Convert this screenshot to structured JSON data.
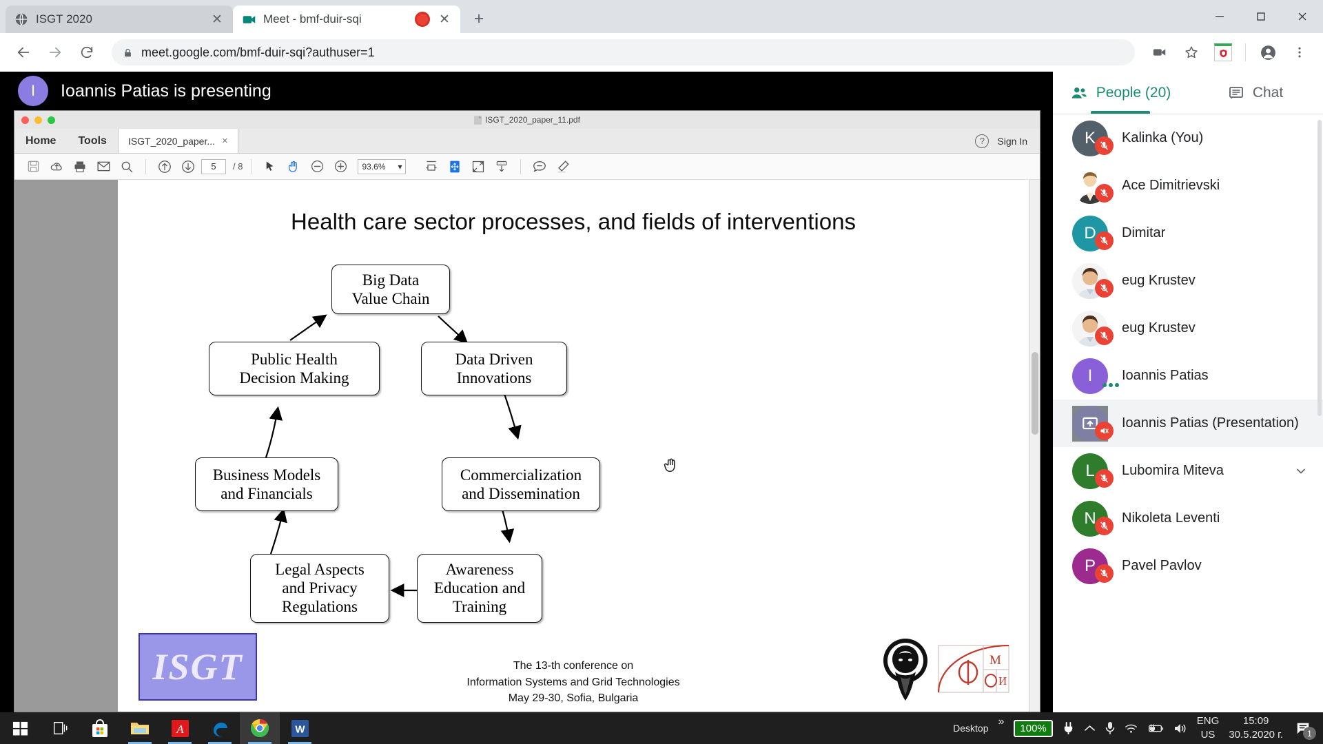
{
  "browser": {
    "tabs": [
      {
        "title": "ISGT 2020",
        "favicon": "globe-icon",
        "active": false,
        "recording": false
      },
      {
        "title": "Meet - bmf-duir-sqi",
        "favicon": "meet-icon",
        "active": true,
        "recording": true
      }
    ],
    "new_tab_label": "+",
    "window_controls": {
      "minimize": "—",
      "maximize": "☐",
      "close": "✕"
    },
    "url": "meet.google.com/bmf-duir-sqi?authuser=1",
    "nav": {
      "back": "←",
      "forward": "→",
      "reload": "↻"
    },
    "icons": {
      "lock": "lock-icon",
      "camera": "camera-icon",
      "bookmark": "star-icon",
      "extension": "avast-extension-icon",
      "profile": "profile-icon",
      "menu": "kebab-menu-icon"
    }
  },
  "meet": {
    "presenting": {
      "avatar_letter": "I",
      "text": "Ioannis Patias is presenting",
      "avatar_color": "#8a7ce0"
    },
    "panel": {
      "tabs": [
        {
          "label": "People (20)",
          "icon": "people-icon",
          "active": true
        },
        {
          "label": "Chat",
          "icon": "chat-icon",
          "active": false
        }
      ],
      "participants": [
        {
          "name": "Kalinka (You)",
          "initial": "K",
          "color": "#546069",
          "type": "initial",
          "muted": true,
          "highlight": false
        },
        {
          "name": "Ace Dimitrievski",
          "initial": "",
          "color": "#ffffff",
          "type": "photo-generic",
          "muted": true,
          "highlight": false
        },
        {
          "name": "Dimitar",
          "initial": "D",
          "color": "#1f96a4",
          "type": "initial",
          "muted": true,
          "highlight": false
        },
        {
          "name": "eug Krustev",
          "initial": "",
          "color": "#ffffff",
          "type": "photo-man",
          "muted": true,
          "highlight": false
        },
        {
          "name": "eug Krustev",
          "initial": "",
          "color": "#ffffff",
          "type": "photo-man",
          "muted": true,
          "highlight": false
        },
        {
          "name": "Ioannis Patias",
          "initial": "I",
          "color": "#8a60d8",
          "type": "initial",
          "muted": false,
          "speaking": true,
          "highlight": false
        },
        {
          "name": "Ioannis Patias (Presentation)",
          "initial": "",
          "color": "#7e7fa3",
          "type": "presentation",
          "muted": true,
          "audio_off": true,
          "highlight": true
        },
        {
          "name": "Lubomira Miteva",
          "initial": "L",
          "color": "#2d7d2d",
          "type": "initial",
          "muted": true,
          "highlight": false,
          "expandable": true
        },
        {
          "name": "Nikoleta Leventi",
          "initial": "N",
          "color": "#2d7d2d",
          "type": "initial",
          "muted": true,
          "highlight": false
        },
        {
          "name": "Pavel Pavlov",
          "initial": "P",
          "color": "#9c2a8f",
          "type": "initial",
          "muted": true,
          "highlight": false
        }
      ],
      "collapse_icon": "collapse-left-arrow-icon"
    }
  },
  "acrobat": {
    "window_filename": "ISGT_2020_paper_11.pdf",
    "menus": [
      "Home",
      "Tools"
    ],
    "document_tab": "ISGT_2020_paper...",
    "document_tab_close": "×",
    "sign_in": "Sign In",
    "help_icon": "help-icon",
    "toolbar": {
      "save_icon": "save-icon",
      "cloud_icon": "cloud-upload-icon",
      "print_icon": "print-icon",
      "email_icon": "email-icon",
      "search_icon": "search-icon",
      "prev_page_icon": "arrow-up-circle-icon",
      "next_page_icon": "arrow-down-circle-icon",
      "page_current": "5",
      "page_total": "/ 8",
      "select_icon": "cursor-select-icon",
      "hand_icon": "hand-tool-icon",
      "zoom_out_icon": "zoom-out-icon",
      "zoom_in_icon": "zoom-in-icon",
      "zoom_value": "93.6%",
      "zoom_caret": "▾",
      "fit_width_icon": "fit-width-icon",
      "pan_icon": "pan-zoom-icon",
      "fit_page_icon": "fit-page-icon",
      "scroll_mode_icon": "scroll-mode-icon",
      "comment_icon": "comment-icon",
      "highlight_icon": "highlight-icon"
    }
  },
  "slide": {
    "title": "Health care sector processes, and fields of interventions",
    "nodes": [
      {
        "id": "big-data",
        "label": "Big Data\nValue Chain"
      },
      {
        "id": "public-health",
        "label": "Public Health\nDecision Making"
      },
      {
        "id": "data-driven",
        "label": "Data Driven\nInnovations"
      },
      {
        "id": "business-models",
        "label": "Business Models\nand Financials"
      },
      {
        "id": "commercialization",
        "label": "Commercialization\nand Dissemination"
      },
      {
        "id": "legal-aspects",
        "label": "Legal Aspects\nand Privacy\nRegulations"
      },
      {
        "id": "awareness",
        "label": "Awareness\nEducation and\nTraining"
      }
    ],
    "footer": {
      "line1": "The 13-th conference on",
      "line2": "Information Systems and Grid Technologies",
      "line3": "May 29-30, Sofia, Bulgaria"
    },
    "logos": {
      "isgt": "ISGT",
      "sofia_university": "sofia-university-logo",
      "fmi": "fmi-logo"
    }
  },
  "taskbar": {
    "start_icon": "windows-start-icon",
    "items": [
      {
        "name": "task-view",
        "icon": "task-view-icon",
        "running": false,
        "active": false
      },
      {
        "name": "microsoft-store",
        "icon": "store-icon",
        "running": false,
        "active": false
      },
      {
        "name": "file-explorer",
        "icon": "folder-icon",
        "running": true,
        "active": false
      },
      {
        "name": "acrobat-reader",
        "icon": "acrobat-icon",
        "running": true,
        "active": false
      },
      {
        "name": "microsoft-edge",
        "icon": "edge-icon",
        "running": true,
        "active": false
      },
      {
        "name": "google-chrome",
        "icon": "chrome-icon",
        "running": true,
        "active": true
      },
      {
        "name": "microsoft-word",
        "icon": "word-icon",
        "running": true,
        "active": false
      }
    ],
    "tray": {
      "show_desktop": "Desktop",
      "overflow": "»",
      "battery_percent": "100%",
      "plug_icon": "power-plug-icon",
      "chevron_icon": "show-hidden-icons-icon",
      "mic_icon": "microphone-icon",
      "wifi_icon": "wifi-icon",
      "battery_icon": "battery-charging-icon",
      "volume_icon": "volume-icon",
      "language_line1": "ENG",
      "language_line2": "US",
      "time": "15:09",
      "date": "30.5.2020 г.",
      "notification_icon": "notifications-icon",
      "notification_count": "1"
    }
  }
}
